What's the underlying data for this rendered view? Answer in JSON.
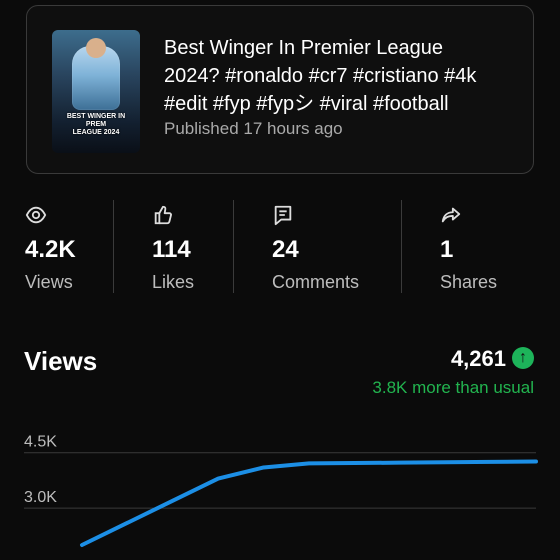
{
  "video": {
    "title": "Best Winger In Premier League\n2024? #ronaldo #cr7 #cristiano #4k\n#edit #fyp #fypシ #viral #football",
    "published": "Published 17 hours ago",
    "thumbnail_overlay": {
      "line1": "BEST WINGER IN PREM",
      "line2": "LEAGUE 2024"
    }
  },
  "stats": [
    {
      "value": "4.2K",
      "label": "Views",
      "icon": "eye-icon"
    },
    {
      "value": "114",
      "label": "Likes",
      "icon": "thumb-up-icon"
    },
    {
      "value": "24",
      "label": "Comments",
      "icon": "comment-icon"
    },
    {
      "value": "1",
      "label": "Shares",
      "icon": "share-icon"
    }
  ],
  "views_section": {
    "header": "Views",
    "total": "4,261",
    "trend_text": "3.8K more than usual",
    "trend_icon": "arrow-up-icon"
  },
  "chart_data": {
    "type": "line",
    "xlabel": "",
    "ylabel": "",
    "ylim": [
      2000,
      4600
    ],
    "y_ticks": [
      "4.5K",
      "3.0K"
    ],
    "series": [
      {
        "values": [
          2000,
          2600,
          3200,
          3800,
          4100,
          4210,
          4220,
          4230,
          4240,
          4250,
          4261
        ]
      }
    ],
    "x": [
      0,
      1,
      2,
      3,
      4,
      5,
      6,
      7,
      8,
      9,
      10
    ],
    "colors": {
      "line": "#1c8fe6",
      "grid": "#3a3a3a"
    },
    "grid": true
  },
  "colors": {
    "accent_green": "#22b44f",
    "line_blue": "#1c8fe6",
    "text_muted": "#bdbdbd"
  }
}
